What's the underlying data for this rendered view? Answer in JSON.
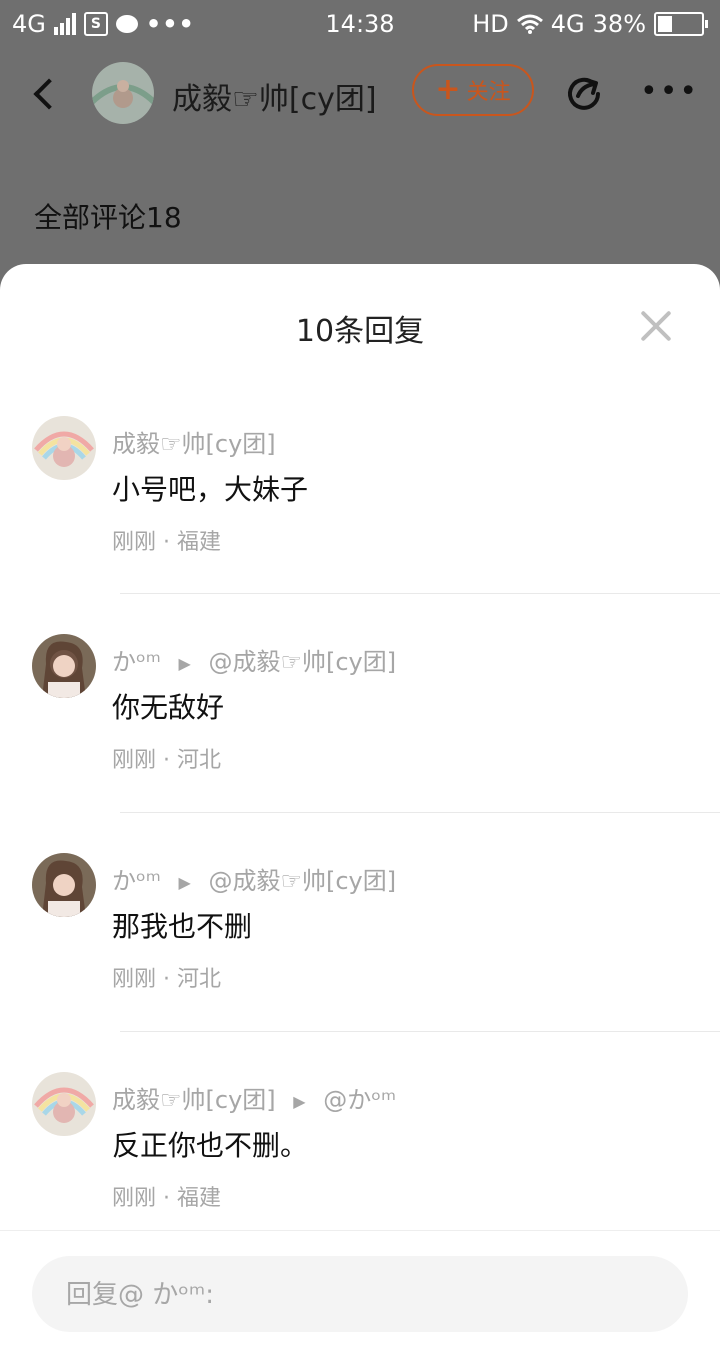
{
  "statusbar": {
    "network": "4G",
    "square_icon_text": "S",
    "dots": "•••",
    "time": "14:38",
    "hd": "HD",
    "network2": "4G",
    "battery": "38%",
    "battery_level": 0.38
  },
  "nav": {
    "name": "成毅☞帅[cy团]",
    "follow_label": "关注",
    "more": "•••"
  },
  "comments_header": "全部评论18",
  "sheet": {
    "title": "10条回复"
  },
  "replies": [
    {
      "author": "成毅☞帅[cy团]",
      "target": "",
      "text": "小号吧，大妹子",
      "meta": "刚刚 · 福建"
    },
    {
      "author": "かᵒᵐ",
      "target": "@成毅☞帅[cy团]",
      "text": "你无敌好",
      "meta": "刚刚 · 河北"
    },
    {
      "author": "かᵒᵐ",
      "target": "@成毅☞帅[cy团]",
      "text": "那我也不删",
      "meta": "刚刚 · 河北"
    },
    {
      "author": "成毅☞帅[cy团]",
      "target": "@かᵒᵐ",
      "text": "反正你也不删。",
      "meta": "刚刚 · 福建"
    }
  ],
  "composer": {
    "placeholder": "回复@ かᵒᵐ:"
  }
}
